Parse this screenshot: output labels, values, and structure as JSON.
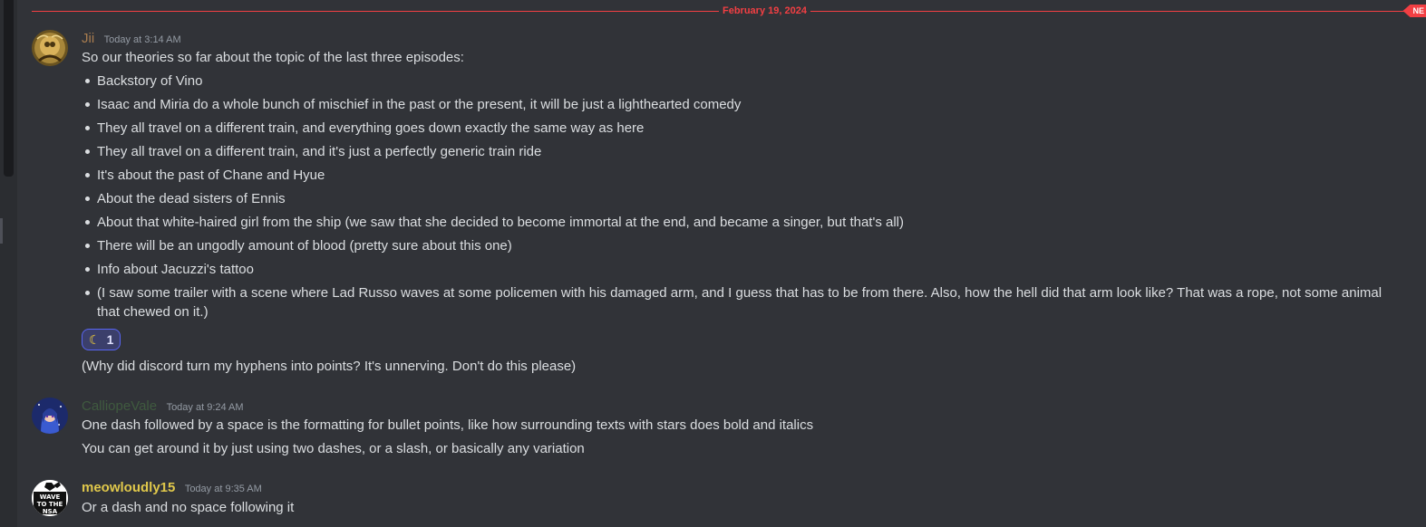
{
  "date_divider": {
    "label": "February 19, 2024",
    "new_badge": "NE"
  },
  "colors": {
    "background": "#313338",
    "divider_red": "#f23f43",
    "username_jii": "#a87c4f",
    "username_calliope": "#3f5a3f",
    "username_meow": "#e0c84b",
    "reaction_border": "#5865f2"
  },
  "messages": [
    {
      "username": "Jii",
      "timestamp": "Today at 3:14 AM",
      "intro": "So our theories so far about the topic of the last three episodes:",
      "bullets": [
        "Backstory of Vino",
        "Isaac and Miria do a whole bunch of mischief in the past or the present, it will be just a lighthearted comedy",
        "They all travel on a different train, and everything goes down exactly the same way as here",
        "They all travel on a different train, and it's just a perfectly generic train ride",
        "It's about the past of Chane and Hyue",
        "About the dead sisters of Ennis",
        "About that white-haired girl from the ship (we saw that she decided to become immortal at the end, and became a singer, but that's all)",
        "There will be an ungodly amount of blood (pretty sure about this one)",
        "Info about Jacuzzi's tattoo",
        "(I saw some trailer with a scene where Lad Russo waves at some policemen with his damaged arm, and I guess that has to be from there. Also, how the hell did that arm look like? That was a rope, not some animal that chewed on it.)"
      ],
      "reaction": {
        "emoji": "crescent-moon-icon",
        "glyph": "☾",
        "count": "1"
      },
      "followup": "(Why did discord turn my hyphens into points? It's unnerving. Don't do this please)"
    },
    {
      "username": "CalliopeVale",
      "timestamp": "Today at 9:24 AM",
      "lines": [
        "One dash followed by a space is the formatting for bullet points, like how surrounding texts with stars does bold and italics",
        "You can get around it by just using two dashes, or a slash, or basically any variation"
      ]
    },
    {
      "username": "meowloudly15",
      "timestamp": "Today at 9:35 AM",
      "avatar_text": "WAVE TO THE NSA",
      "lines": [
        "Or a dash and no space following it"
      ]
    }
  ]
}
